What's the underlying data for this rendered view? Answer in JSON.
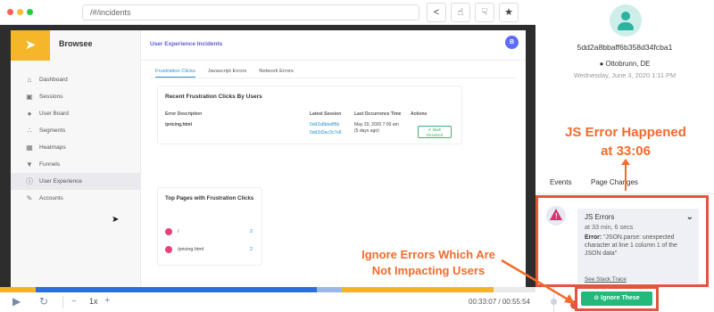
{
  "browser": {
    "url": "/#/incidents",
    "dot_colors": [
      "#ff5f56",
      "#ffbd2e",
      "#27c93f"
    ],
    "toolbar_icons": [
      "share-icon",
      "thumbs-up-icon",
      "thumbs-down-icon",
      "star-icon"
    ]
  },
  "app": {
    "brand": "Browsee",
    "logo_icon": "rocket-icon",
    "header_title": "User Experience Incidents",
    "avatar_letter": "B",
    "nav": [
      {
        "label": "Dashboard",
        "icon": "home-icon"
      },
      {
        "label": "Sessions",
        "icon": "camera-icon"
      },
      {
        "label": "User Board",
        "icon": "user-icon"
      },
      {
        "label": "Segments",
        "icon": "segments-icon"
      },
      {
        "label": "Heatmaps",
        "icon": "heatmap-icon"
      },
      {
        "label": "Funnels",
        "icon": "funnel-icon"
      },
      {
        "label": "User Experience",
        "icon": "info-icon",
        "active": true
      },
      {
        "label": "Accounts",
        "icon": "accounts-icon"
      }
    ],
    "tabs": [
      "Frustration Clicks",
      "Javascript Errors",
      "Network Errors"
    ],
    "card1": {
      "title": "Recent Frustration Clicks By Users",
      "headers": [
        "Error Description",
        "Latest Session",
        "Last Occurrence Time",
        "Actions"
      ],
      "row": {
        "description": "/pricing.html",
        "sessions": [
          "5dd2a8bbaff6b",
          "5dd2d3ac3c7e8"
        ],
        "time": "May 20, 2020 7:00 am",
        "time_ago": "(5 days ago)",
        "action_line1": "Mark",
        "action_line2": "Resolved"
      }
    },
    "card2": {
      "title": "Top Pages with Frustration Clicks",
      "pages": [
        {
          "name": "/",
          "count": "2"
        },
        {
          "name": "/pricing.html",
          "count": "2"
        }
      ]
    }
  },
  "player": {
    "speed": "1x",
    "minus": "−",
    "plus": "+",
    "time": "00:33:07 / 00:55:54",
    "progress_played": 0.59,
    "progress_color": "#2a6fdb",
    "buffer_color": "#f6b22a"
  },
  "user": {
    "id": "5dd2a8bbaff6b358d34fcba1",
    "location": "Ottobrunn, DE",
    "date": "Wednesday, June 3, 2020 1:11 PM"
  },
  "annotations": {
    "js_error_line1": "JS Error Happened",
    "js_error_line2": "at 33:06",
    "ignore_line1": "Ignore Errors Which Are",
    "ignore_line2": "Not Impacting Users",
    "color": "#f36b2d"
  },
  "panel": {
    "tabs": [
      "Events",
      "Page Changes"
    ],
    "event": {
      "title": "JS Errors",
      "subtitle": "at 33 min, 6 secs",
      "error_label": "Error:",
      "error_text": "\"JSON.parse: unexpected character at line 1 column 1 of the JSON data\"",
      "stack_link": "See Stack Trace"
    },
    "ignore_button": "Ignore These",
    "highlight_color": "#e2553f"
  }
}
